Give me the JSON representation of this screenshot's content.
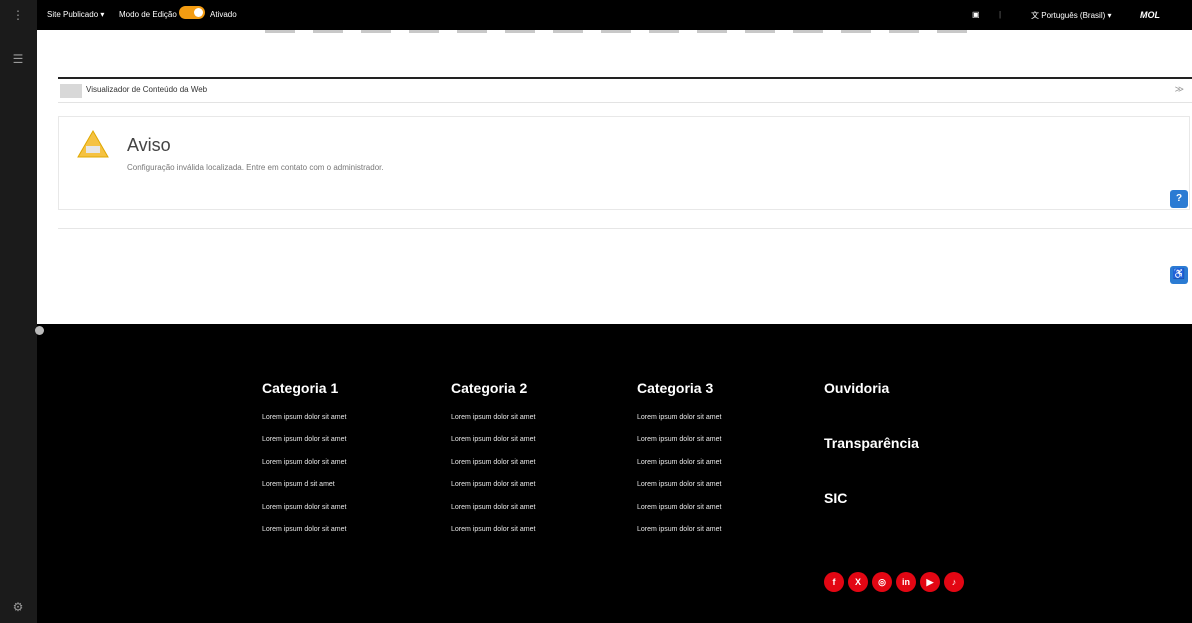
{
  "topbar": {
    "site_dropdown": "Site Publicado",
    "edit_mode_label": "Modo de Edição",
    "edit_mode_state": "Ativado",
    "language": "Português (Brasil)",
    "brand": "MOL"
  },
  "portlet": {
    "title": "Visualizador de Conteúdo da Web"
  },
  "alert": {
    "title": "Aviso",
    "message": "Configuração inválida localizada. Entre em contato com o administrador."
  },
  "footer": {
    "columns": [
      {
        "title": "Categoria 1",
        "links": [
          "Lorem ipsum dolor sit amet",
          "Lorem ipsum dolor sit amet",
          "Lorem ipsum dolor sit amet",
          "Lorem ipsum d      sit amet",
          "Lorem ipsum dolor sit amet",
          "Lorem ipsum dolor sit amet"
        ]
      },
      {
        "title": "Categoria 2",
        "links": [
          "Lorem ipsum dolor sit amet",
          "Lorem ipsum dolor sit amet",
          "Lorem ipsum dolor sit amet",
          "Lorem ipsum dolor sit amet",
          "Lorem ipsum dolor sit amet",
          "Lorem ipsum dolor sit amet"
        ]
      },
      {
        "title": "Categoria 3",
        "links": [
          "Lorem ipsum dolor sit amet",
          "Lorem ipsum dolor sit amet",
          "Lorem ipsum dolor sit amet",
          "Lorem ipsum dolor sit amet",
          "Lorem ipsum dolor sit amet",
          "Lorem ipsum dolor sit amet"
        ]
      }
    ],
    "right_links": [
      "Ouvidoria",
      "Transparência",
      "SIC"
    ],
    "social": [
      {
        "name": "facebook-icon",
        "glyph": "f"
      },
      {
        "name": "x-twitter-icon",
        "glyph": "X"
      },
      {
        "name": "instagram-icon",
        "glyph": "◎"
      },
      {
        "name": "linkedin-icon",
        "glyph": "in"
      },
      {
        "name": "youtube-icon",
        "glyph": "▶"
      },
      {
        "name": "tiktok-icon",
        "glyph": "♪"
      }
    ]
  },
  "colors": {
    "accent": "#f39c12",
    "social_red": "#e30613",
    "footer_bg": "#000000",
    "fab_blue": "#2b7bd3"
  }
}
